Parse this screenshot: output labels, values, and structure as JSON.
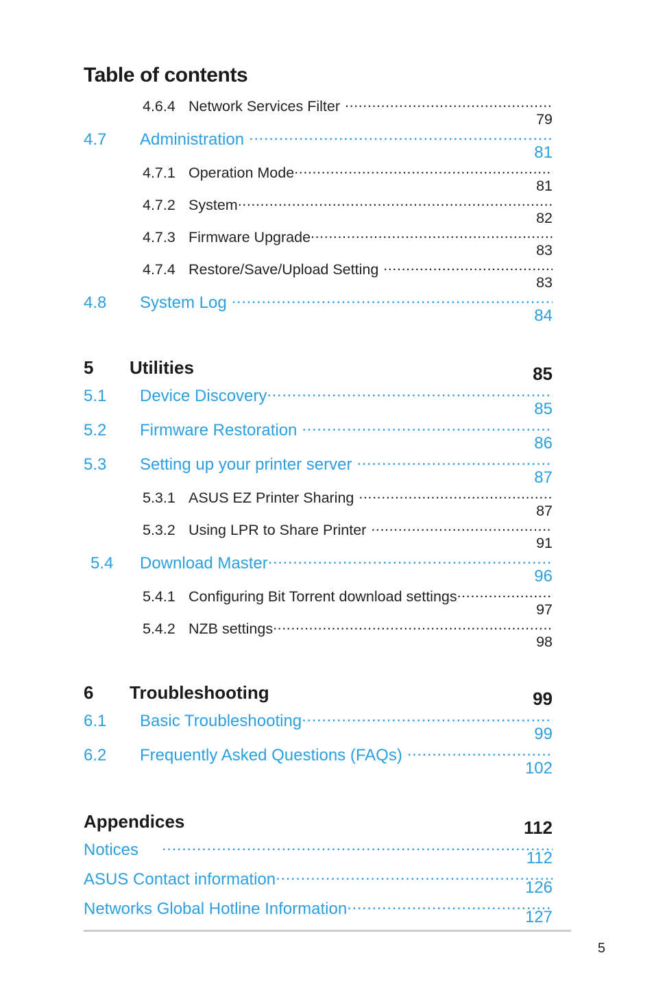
{
  "document": {
    "heading": "Table of contents",
    "accent_color": "#2b9fdf",
    "text_color": "#221f1f",
    "rule_color": "#cccccc"
  },
  "footer": {
    "page_number": "5"
  },
  "entries": [
    {
      "level": 3,
      "number": "4.6.4",
      "label": "Network Services Filter",
      "page": "79"
    },
    {
      "level": 2,
      "number": "4.7",
      "label": "Administration",
      "page": "81"
    },
    {
      "level": 3,
      "number": "4.7.1",
      "label": "Operation Mode",
      "page": "81"
    },
    {
      "level": 3,
      "number": "4.7.2",
      "label": "System",
      "page": "82"
    },
    {
      "level": 3,
      "number": "4.7.3",
      "label": "Firmware Upgrade",
      "page": "83"
    },
    {
      "level": 3,
      "number": "4.7.4",
      "label": "Restore/Save/Upload Setting",
      "page": "83"
    },
    {
      "level": 2,
      "number": "4.8",
      "label": "System Log",
      "page": "84"
    },
    {
      "level": 1,
      "number": "5",
      "label": "Utilities",
      "page": "85"
    },
    {
      "level": 2,
      "number": "5.1",
      "label": "Device Discovery",
      "page": "85"
    },
    {
      "level": 2,
      "number": "5.2",
      "label": "Firmware Restoration",
      "page": "86"
    },
    {
      "level": 2,
      "number": "5.3",
      "label": "Setting up your printer server",
      "page": "87"
    },
    {
      "level": 3,
      "number": "5.3.1",
      "label": "ASUS EZ Printer Sharing",
      "page": "87"
    },
    {
      "level": 3,
      "number": "5.3.2",
      "label": "Using LPR to Share Printer",
      "page": "91"
    },
    {
      "level": 2,
      "number": "5.4",
      "label": "Download Master",
      "page": "96"
    },
    {
      "level": 3,
      "number": "5.4.1",
      "label": "Configuring Bit Torrent download settings",
      "page": "97"
    },
    {
      "level": 3,
      "number": "5.4.2",
      "label": "NZB settings",
      "page": "98"
    },
    {
      "level": 1,
      "number": "6",
      "label": "Troubleshooting",
      "page": "99"
    },
    {
      "level": 2,
      "number": "6.1",
      "label": "Basic Troubleshooting",
      "page": "99"
    },
    {
      "level": 2,
      "number": "6.2",
      "label": "Frequently Asked Questions (FAQs)",
      "page": "102"
    },
    {
      "level": 1,
      "number": "",
      "label": "Appendices",
      "page": "112"
    },
    {
      "level": 0,
      "number": "",
      "label": "Notices",
      "page": "112"
    },
    {
      "level": 0,
      "number": "",
      "label": "ASUS Contact information",
      "page": "126"
    },
    {
      "level": 0,
      "number": "",
      "label": "Networks Global Hotline Information",
      "page": "127"
    }
  ]
}
